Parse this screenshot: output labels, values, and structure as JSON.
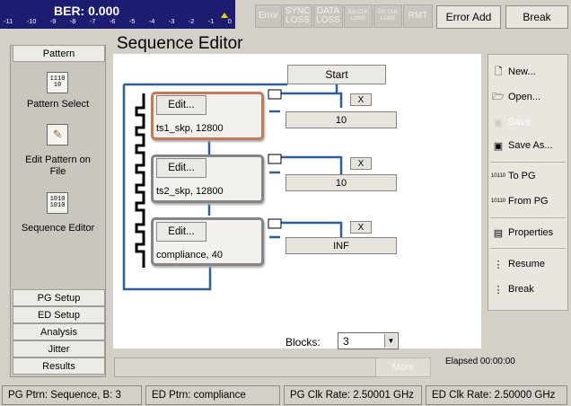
{
  "ber": {
    "title": "BER: 0.000",
    "scale": [
      "-11",
      "-10",
      "-9",
      "-8",
      "-7",
      "-6",
      "-5",
      "-4",
      "-3",
      "-2",
      "-1",
      "0"
    ]
  },
  "status_indicators": [
    {
      "label": "Error"
    },
    {
      "label": "SYNC LOSS"
    },
    {
      "label": "DATA LOSS"
    },
    {
      "label": "ED CLK LOSS"
    },
    {
      "label": "PG CLK LOSS"
    },
    {
      "label": "RMT"
    }
  ],
  "toolbar": {
    "error_add_label": "Error Add",
    "break_label": "Break"
  },
  "left_nav": {
    "pattern_tab": "Pattern",
    "items": [
      {
        "label": "Pattern Select",
        "icon": "pattern-select-icon",
        "glyph": "1110\n10"
      },
      {
        "label": "Edit Pattern on\nFile",
        "icon": "edit-pattern-icon",
        "glyph": "✎"
      },
      {
        "label": "Sequence Editor",
        "icon": "sequence-editor-icon",
        "glyph": "1010\n1010"
      }
    ],
    "tabs": [
      "PG Setup",
      "ED Setup",
      "Analysis",
      "Jitter",
      "Results"
    ]
  },
  "editor": {
    "title": "Sequence Editor",
    "start_label": "Start",
    "blocks": [
      {
        "edit_label": "Edit...",
        "name": "ts1_skp, 12800",
        "loop": "10",
        "close": "X"
      },
      {
        "edit_label": "Edit...",
        "name": "ts2_skp, 12800",
        "loop": "10",
        "close": "X"
      },
      {
        "edit_label": "Edit...",
        "name": "compliance, 40",
        "loop": "INF",
        "close": "X"
      }
    ],
    "blocks_label": "Blocks:",
    "blocks_value": "3"
  },
  "right_panel": {
    "new": "New...",
    "open": "Open...",
    "save": "Save",
    "save_as": "Save As...",
    "to_pg": "To PG",
    "from_pg": "From PG",
    "properties": "Properties",
    "resume": "Resume",
    "break": "Break"
  },
  "bottom": {
    "more_label": "More",
    "elapsed": "Elapsed 00:00:00"
  },
  "statusbar": {
    "pg_ptrn": "PG Ptrn: Sequence, B: 3",
    "ed_ptrn": "ED Ptrn: compliance",
    "pg_clk": "PG Clk Rate: 2.50001 GHz",
    "ed_clk": "ED Clk Rate: 2.50000 GHz"
  },
  "colors": {
    "ber_bg": "#1c1c70",
    "flow_line": "#2f5f9a",
    "selected_border": "#c47a5a"
  }
}
